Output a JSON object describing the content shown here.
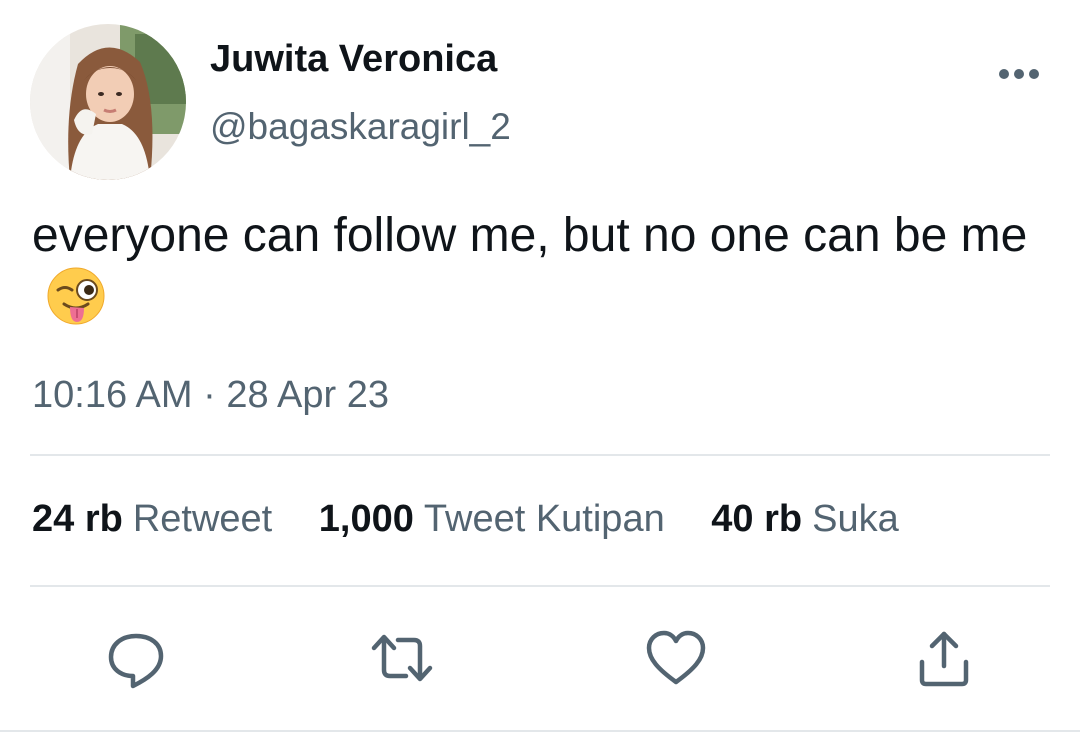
{
  "author": {
    "display_name": "Juwita Veronica",
    "handle": "@bagaskaragirl_2"
  },
  "tweet": {
    "text": "everyone can follow me, but no one can be me",
    "emoji": "winking-face-with-tongue",
    "timestamp": "10:16 AM · 28 Apr 23"
  },
  "stats": [
    {
      "count": "24 rb",
      "label": "Retweet"
    },
    {
      "count": "1,000",
      "label": "Tweet Kutipan"
    },
    {
      "count": "40 rb",
      "label": "Suka"
    }
  ],
  "actions": [
    "reply-icon",
    "retweet-icon",
    "like-icon",
    "share-icon"
  ],
  "colors": {
    "text_primary": "#0f1419",
    "text_secondary": "#536471",
    "divider": "#e3e7ea"
  }
}
